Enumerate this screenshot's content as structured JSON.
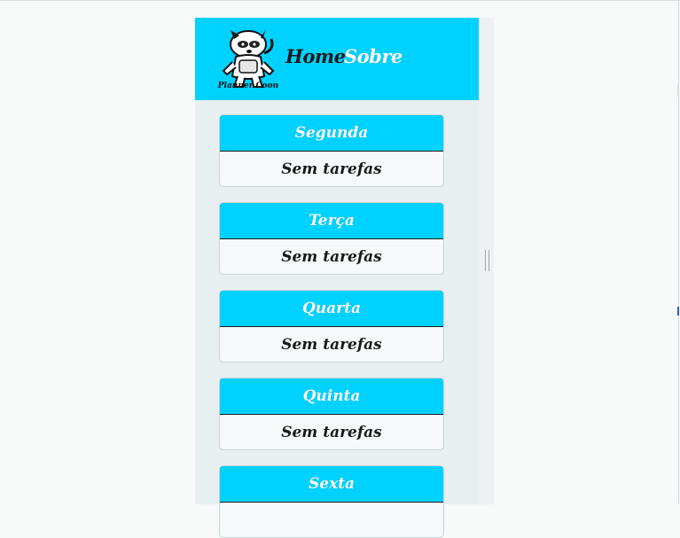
{
  "header": {
    "logo_text": "Planner Coon",
    "nav": [
      {
        "label": "Home"
      },
      {
        "label": "Sobre"
      }
    ]
  },
  "days": [
    {
      "name": "Segunda",
      "tasks_text": "Sem tarefas"
    },
    {
      "name": "Terça",
      "tasks_text": "Sem tarefas"
    },
    {
      "name": "Quarta",
      "tasks_text": "Sem tarefas"
    },
    {
      "name": "Quinta",
      "tasks_text": "Sem tarefas"
    },
    {
      "name": "Sexta",
      "tasks_text": ""
    }
  ],
  "colors": {
    "accent": "#00d2ff",
    "page_bg": "#e8eff1",
    "card_bg": "#f5f9fa",
    "text_dark": "#1a1a1a"
  }
}
